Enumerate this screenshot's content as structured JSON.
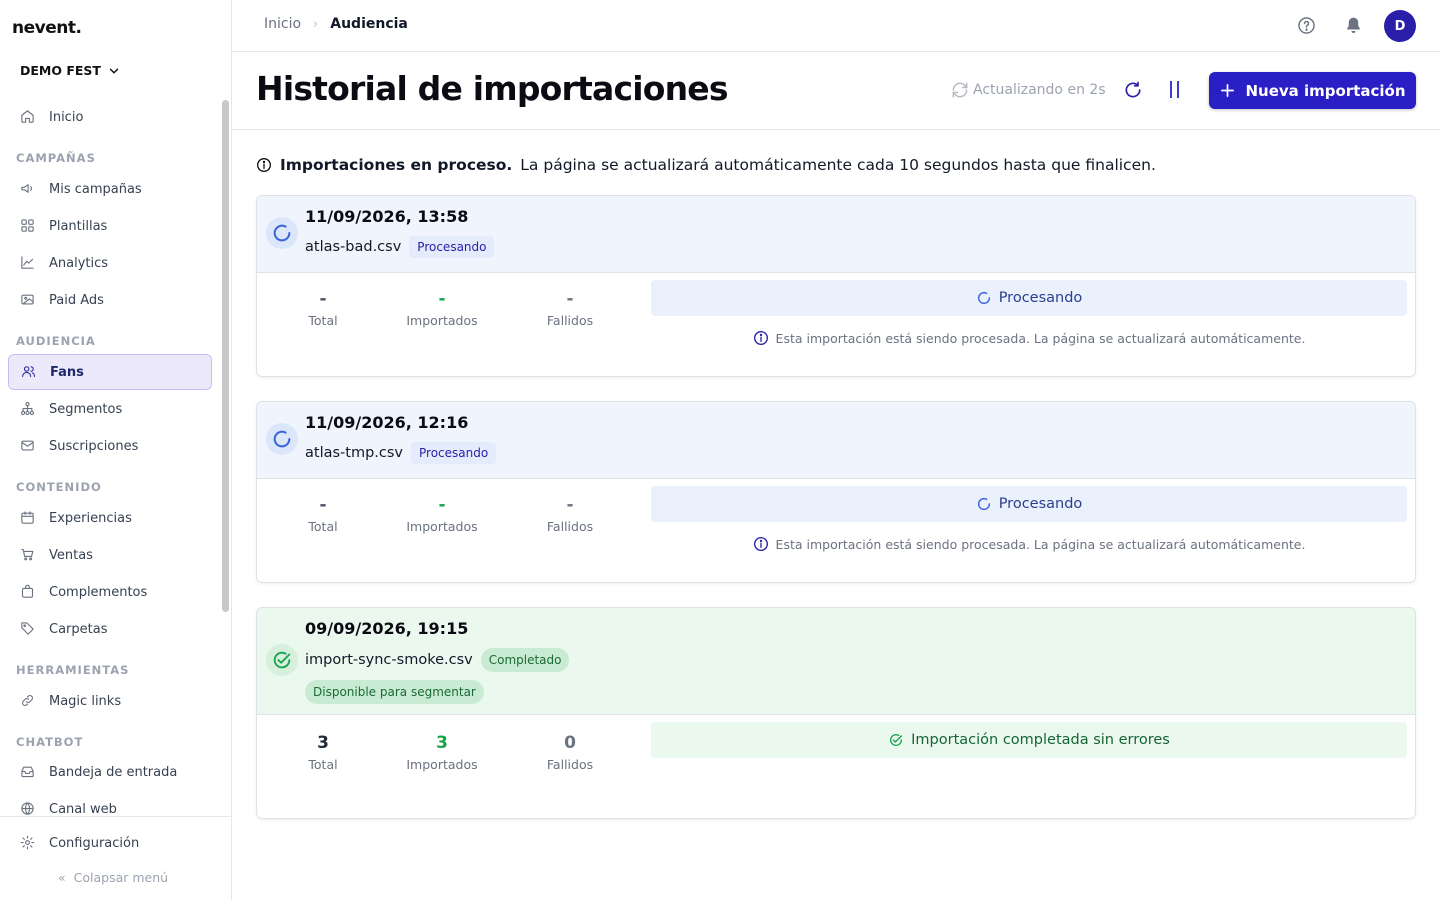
{
  "app": {
    "logo": "nevent.",
    "org": "DEMO FEST"
  },
  "sidebar": {
    "sections": {
      "campaigns": "CAMPAÑAS",
      "audience": "AUDIENCIA",
      "content": "CONTENIDO",
      "tools": "HERRAMIENTAS",
      "chatbot": "CHATBOT"
    },
    "items": {
      "inicio": "Inicio",
      "mis_campanas": "Mis campañas",
      "plantillas": "Plantillas",
      "analytics": "Analytics",
      "paid_ads": "Paid Ads",
      "fans": "Fans",
      "segmentos": "Segmentos",
      "suscripciones": "Suscripciones",
      "experiencias": "Experiencias",
      "ventas": "Ventas",
      "complementos": "Complementos",
      "carpetas": "Carpetas",
      "magic_links": "Magic links",
      "bandeja": "Bandeja de entrada",
      "canal_web": "Canal web"
    },
    "active_item": "Fans",
    "config": "Configuración",
    "collapse": "Colapsar menú"
  },
  "topbar": {
    "breadcrumb": [
      "Inicio",
      "Audiencia"
    ],
    "avatar_initial": "D"
  },
  "header": {
    "title": "Historial de importaciones",
    "refresh_status": "Actualizando en 2s",
    "new_import_label": "Nueva importación"
  },
  "info": {
    "bold": "Importaciones en proceso.",
    "text": "La página se actualizará automáticamente cada 10 segundos hasta que finalicen."
  },
  "labels": {
    "total": "Total",
    "imported": "Importados",
    "failed": "Fallidos",
    "processing_note": "Esta importación está siendo procesada. La página se actualizará automáticamente."
  },
  "imports": [
    {
      "date": "11/09/2026, 13:58",
      "file": "atlas-bad.csv",
      "status": "Procesando",
      "total": "-",
      "imported": "-",
      "failed": "-",
      "result": "Procesando"
    },
    {
      "date": "11/09/2026, 12:16",
      "file": "atlas-tmp.csv",
      "status": "Procesando",
      "total": "-",
      "imported": "-",
      "failed": "-",
      "result": "Procesando"
    },
    {
      "date": "09/09/2026, 19:15",
      "file": "import-sync-smoke.csv",
      "status": "Completado",
      "segment_badge": "Disponible para segmentar",
      "total": "3",
      "imported": "3",
      "failed": "0",
      "result": "Importación completada sin errores"
    }
  ],
  "colors": {
    "brand": "#2a1fc4",
    "processing_bg": "#eff4fd",
    "completed_bg": "#ebf8ee",
    "success": "#16a34a"
  }
}
